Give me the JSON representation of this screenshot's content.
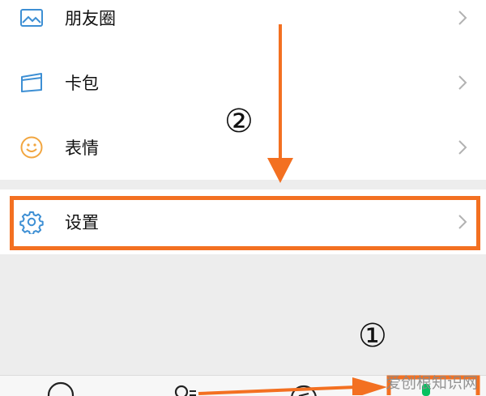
{
  "menu": {
    "moments_label": "朋友圈",
    "cards_label": "卡包",
    "stickers_label": "表情",
    "settings_label": "设置"
  },
  "annotations": {
    "step_one": "①",
    "step_two": "②",
    "highlight_color": "#f37021"
  },
  "tabbar": {
    "tabs": [
      "chat-icon",
      "contacts-icon",
      "discover-icon",
      "me-icon"
    ],
    "active_tab": "me-icon"
  },
  "watermark": {
    "text": "爱创根知识网"
  },
  "colors": {
    "icon_blue": "#3d8fd4",
    "icon_amber": "#f2a640",
    "accent_green": "#07c160",
    "separator_band": "#ededed"
  }
}
